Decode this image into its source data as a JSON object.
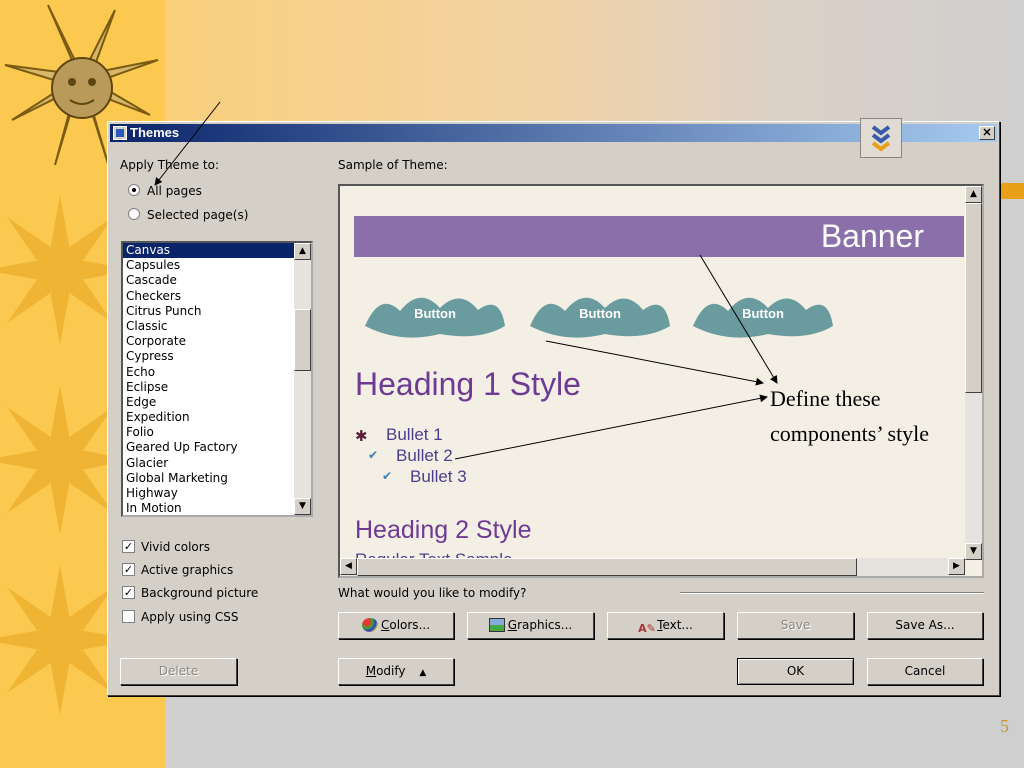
{
  "dialog": {
    "title": "Themes",
    "close_label": "✕",
    "apply_theme_label": "Apply Theme to:",
    "radio_all": "All pages",
    "radio_selected": "Selected page(s)",
    "sample_label": "Sample of Theme:",
    "themes": [
      "Canvas",
      "Capsules",
      "Cascade",
      "Checkers",
      "Citrus Punch",
      "Classic",
      "Corporate",
      "Cypress",
      "Echo",
      "Eclipse",
      "Edge",
      "Expedition",
      "Folio",
      "Geared Up Factory",
      "Glacier",
      "Global Marketing",
      "Highway",
      "In Motion"
    ],
    "selected_theme": "Canvas",
    "options": {
      "vivid": "Vivid colors",
      "active": "Active graphics",
      "background": "Background picture",
      "css": "Apply using CSS"
    },
    "modify_question": "What would you like to modify?",
    "buttons": {
      "colors": "olors...",
      "colors_hot": "C",
      "graphics": "raphics...",
      "graphics_hot": "G",
      "text": "ext...",
      "text_hot": "T",
      "save": "Save",
      "save_as": "Save As...",
      "delete": "Delete",
      "modify": "odify",
      "modify_hot": "M",
      "modify_arrow": "▲",
      "ok": "OK",
      "cancel": "Cancel"
    }
  },
  "preview": {
    "banner": "Banner",
    "button": "Button",
    "heading1": "Heading 1 Style",
    "bullet1": "Bullet 1",
    "bullet2": "Bullet 2",
    "bullet3": "Bullet 3",
    "heading2": "Heading 2 Style",
    "regular": "Regular Text Sample"
  },
  "annotation": {
    "line1": "Define these",
    "line2": "components’ style"
  },
  "slide": {
    "page_number": "5"
  }
}
